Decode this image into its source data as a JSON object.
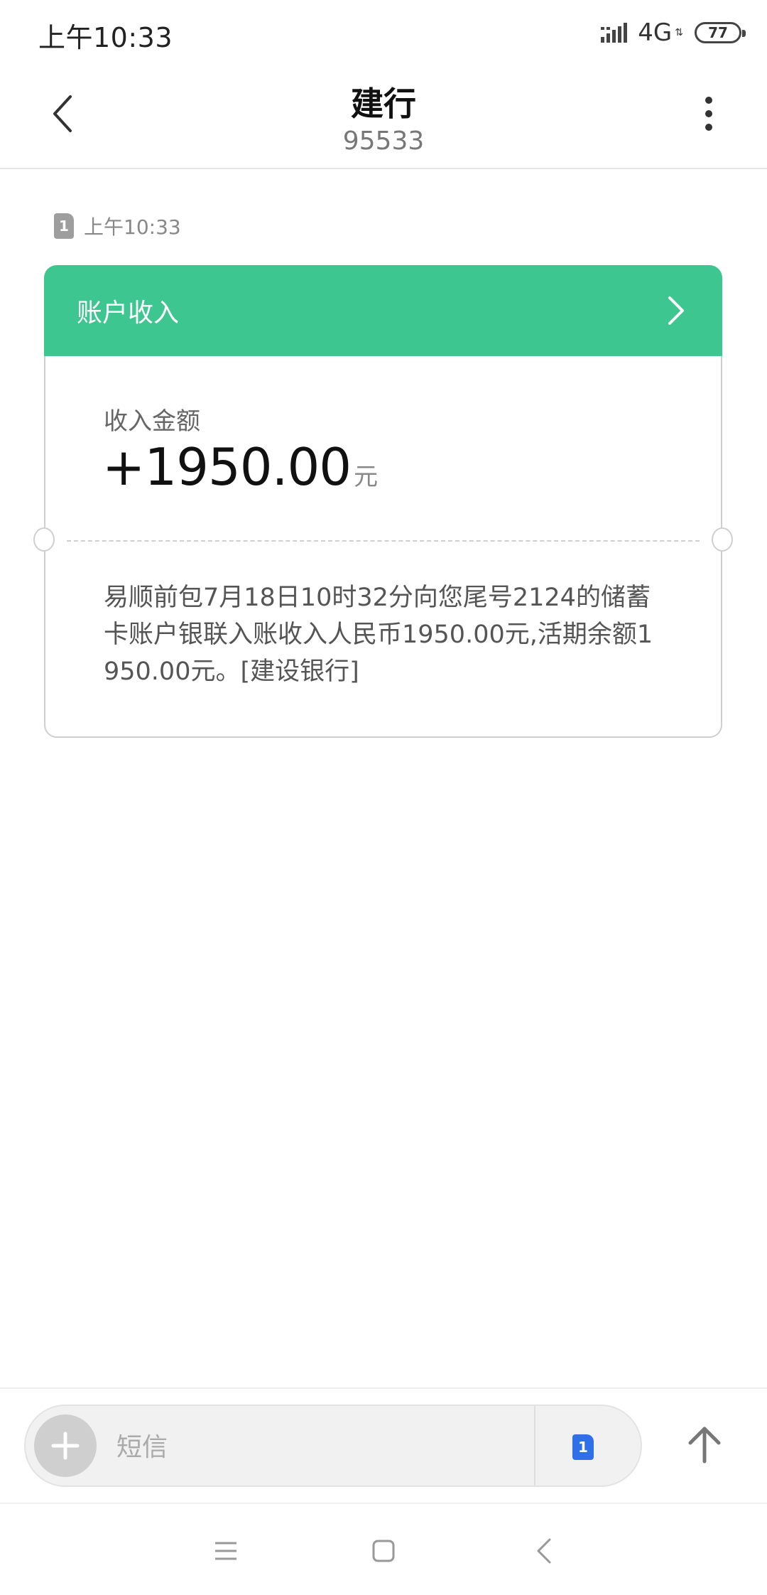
{
  "status_bar": {
    "time": "上午10:33",
    "network": "4G",
    "battery": "77",
    "icons": [
      "signal-icon",
      "battery-icon"
    ]
  },
  "header": {
    "title": "建行",
    "subtitle": "95533",
    "icons": [
      "back-arrow-icon",
      "more-vertical-icon"
    ]
  },
  "message": {
    "sim_slot": "1",
    "time": "上午10:33"
  },
  "card": {
    "title": "账户收入",
    "accent_color": "#3ec691",
    "amount_label": "收入金额",
    "amount": "+1950.00",
    "amount_unit": "元",
    "body": "易顺前包7月18日10时32分向您尾号2124的储蓄卡账户银联入账收入人民币1950.00元,活期余额1950.00元。[建设银行]"
  },
  "composer": {
    "placeholder": "短信",
    "sim_slot": "1",
    "sim_color": "#2f6fe8",
    "icons": [
      "plus-icon",
      "sim-card-icon",
      "send-arrow-icon"
    ]
  },
  "navigation": {
    "icons": [
      "menu-icon",
      "home-icon",
      "back-icon"
    ]
  }
}
